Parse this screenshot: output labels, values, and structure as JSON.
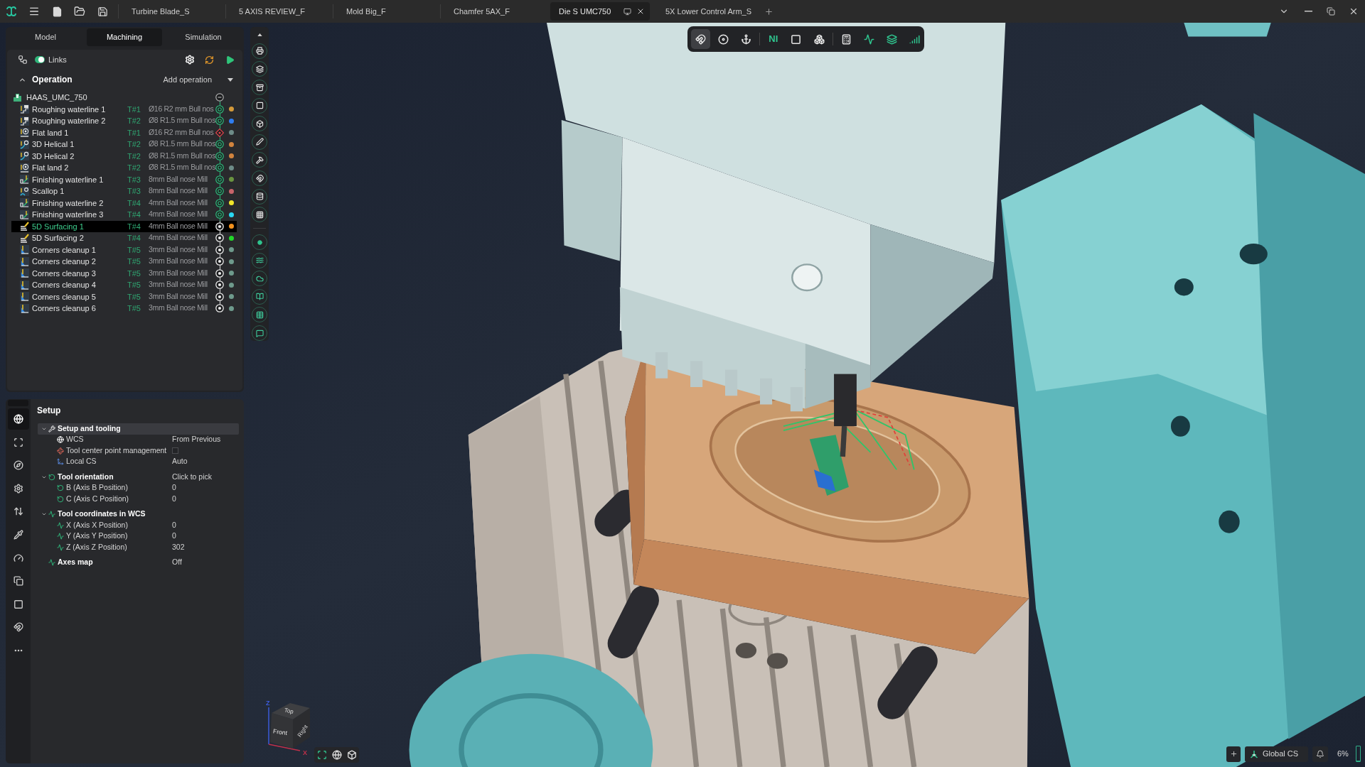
{
  "title_bar": {
    "tabs": [
      {
        "label": "Turbine Blade_S",
        "selected": false
      },
      {
        "label": "5 AXIS REVIEW_F",
        "selected": false
      },
      {
        "label": "Mold Big_F",
        "selected": false
      },
      {
        "label": "Chamfer 5AX_F",
        "selected": false
      },
      {
        "label": "Die S UMC750",
        "selected": true
      },
      {
        "label": "5X Lower Control Arm_S",
        "selected": false
      }
    ]
  },
  "panel_tabs": [
    {
      "label": "Model",
      "selected": false
    },
    {
      "label": "Machining",
      "selected": true
    },
    {
      "label": "Simulation",
      "selected": false
    }
  ],
  "links": {
    "label": "Links",
    "on": true
  },
  "operations": {
    "title": "Operation",
    "expanded": true,
    "add_label": "Add operation",
    "machine": "HAAS_UMC_750",
    "rows": [
      {
        "name": "Roughing waterline 1",
        "kind": "roughing",
        "tool_number": "T#1",
        "tool": "Ø16 R2 mm Bull nos",
        "calculated": true,
        "failed": false,
        "color": "#d49a3a",
        "selected": false
      },
      {
        "name": "Roughing waterline 2",
        "kind": "roughing",
        "tool_number": "T#2",
        "tool": "Ø8 R1.5 mm Bull nos",
        "calculated": true,
        "failed": false,
        "color": "#2f7df0",
        "selected": false
      },
      {
        "name": "Flat land 1",
        "kind": "flat",
        "tool_number": "T#1",
        "tool": "Ø16 R2 mm Bull nos",
        "calculated": true,
        "failed": true,
        "color": "#6e8c88",
        "selected": false
      },
      {
        "name": "3D Helical 1",
        "kind": "helical",
        "tool_number": "T#2",
        "tool": "Ø8 R1.5 mm Bull nos",
        "calculated": true,
        "failed": false,
        "color": "#d2843e",
        "selected": false
      },
      {
        "name": "3D Helical 2",
        "kind": "helical",
        "tool_number": "T#2",
        "tool": "Ø8 R1.5 mm Bull nos",
        "calculated": true,
        "failed": false,
        "color": "#d2843e",
        "selected": false
      },
      {
        "name": "Flat land 2",
        "kind": "flat",
        "tool_number": "T#2",
        "tool": "Ø8 R1.5 mm Bull nos",
        "calculated": true,
        "failed": false,
        "color": "#6e8c88",
        "selected": false
      },
      {
        "name": "Finishing waterline 1",
        "kind": "finishing",
        "tool_number": "T#3",
        "tool": "8mm Ball nose Mill",
        "calculated": true,
        "failed": false,
        "color": "#6a9440",
        "selected": false
      },
      {
        "name": "Scallop 1",
        "kind": "scallop",
        "tool_number": "T#3",
        "tool": "8mm Ball nose Mill",
        "calculated": true,
        "failed": false,
        "color": "#c8646a",
        "selected": false
      },
      {
        "name": "Finishing waterline 2",
        "kind": "finishing",
        "tool_number": "T#4",
        "tool": "4mm Ball nose Mill",
        "calculated": true,
        "failed": false,
        "color": "#f2e62a",
        "selected": false
      },
      {
        "name": "Finishing waterline 3",
        "kind": "finishing",
        "tool_number": "T#4",
        "tool": "4mm Ball nose Mill",
        "calculated": true,
        "failed": false,
        "color": "#2ad8f2",
        "selected": false
      },
      {
        "name": "5D Surfacing 1",
        "kind": "surfacing",
        "tool_number": "T#4",
        "tool": "4mm Ball nose Mill",
        "calculated": false,
        "failed": false,
        "color": "#f2921e",
        "selected": true
      },
      {
        "name": "5D Surfacing 2",
        "kind": "surfacing",
        "tool_number": "T#4",
        "tool": "4mm Ball nose Mill",
        "calculated": false,
        "failed": false,
        "color": "#22d82a",
        "selected": false
      },
      {
        "name": "Corners cleanup 1",
        "kind": "corners",
        "tool_number": "T#5",
        "tool": "3mm Ball nose Mill",
        "calculated": false,
        "failed": false,
        "color": "#6e9a8c",
        "selected": false
      },
      {
        "name": "Corners cleanup 2",
        "kind": "corners",
        "tool_number": "T#5",
        "tool": "3mm Ball nose Mill",
        "calculated": false,
        "failed": false,
        "color": "#6e9a8c",
        "selected": false
      },
      {
        "name": "Corners cleanup 3",
        "kind": "corners",
        "tool_number": "T#5",
        "tool": "3mm Ball nose Mill",
        "calculated": false,
        "failed": false,
        "color": "#6e9a8c",
        "selected": false
      },
      {
        "name": "Corners cleanup 4",
        "kind": "corners",
        "tool_number": "T#5",
        "tool": "3mm Ball nose Mill",
        "calculated": false,
        "failed": false,
        "color": "#6e9a8c",
        "selected": false
      },
      {
        "name": "Corners cleanup 5",
        "kind": "corners",
        "tool_number": "T#5",
        "tool": "3mm Ball nose Mill",
        "calculated": false,
        "failed": false,
        "color": "#6e9a8c",
        "selected": false
      },
      {
        "name": "Corners cleanup 6",
        "kind": "corners",
        "tool_number": "T#5",
        "tool": "3mm Ball nose Mill",
        "calculated": false,
        "failed": false,
        "color": "#6e9a8c",
        "selected": false
      }
    ]
  },
  "viewport_toolbar": [
    {
      "selected": true
    },
    {
      "selected": false
    },
    {
      "selected": false
    },
    {
      "text": "NI",
      "selected": false
    },
    {
      "selected": false
    },
    {
      "selected": false
    },
    {
      "selected": false
    },
    {
      "selected": false
    },
    {
      "selected": false
    },
    {
      "selected": false
    }
  ],
  "setup_sidebar": [
    {
      "selected": true
    },
    {
      "selected": false
    },
    {
      "selected": false
    },
    {
      "selected": false
    },
    {
      "selected": false
    },
    {
      "selected": false
    },
    {
      "selected": false
    },
    {
      "selected": false
    },
    {
      "selected": false
    },
    {
      "selected": false
    },
    {
      "selected": false
    }
  ],
  "setup": {
    "title": "Setup",
    "items": [
      {
        "label": "Setup and tooling",
        "expanded": true,
        "selected": true,
        "children": [
          {
            "label": "WCS",
            "value": "From Previous",
            "selected": false
          },
          {
            "label": "Tool center point management",
            "kind": "checkbox",
            "checked": false,
            "selected": false
          },
          {
            "label": "Local CS",
            "value": "Auto",
            "selected": false
          }
        ]
      },
      {
        "label": "Tool orientation",
        "value": "Click to pick",
        "expanded": true,
        "selected": false,
        "children": [
          {
            "label": "B (Axis B Position)",
            "value": "0",
            "selected": false
          },
          {
            "label": "C (Axis C Position)",
            "value": "0",
            "selected": false
          }
        ]
      },
      {
        "label": "Tool coordinates in WCS",
        "expanded": true,
        "selected": false,
        "children": [
          {
            "label": "X (Axis X Position)",
            "value": "0",
            "selected": false
          },
          {
            "label": "Y (Axis Y Position)",
            "value": "0",
            "selected": false
          },
          {
            "label": "Z (Axis Z Position)",
            "value": "302",
            "selected": false
          }
        ]
      },
      {
        "label": "Axes map",
        "value": "Off",
        "selected": false
      }
    ]
  },
  "view_cube": {
    "axes": [
      "Z",
      "X"
    ],
    "faces": [
      "Top",
      "Front",
      "Right"
    ]
  },
  "status_bar": {
    "coordinate_system": "Global CS",
    "usage": "6%",
    "level": 0.06
  }
}
